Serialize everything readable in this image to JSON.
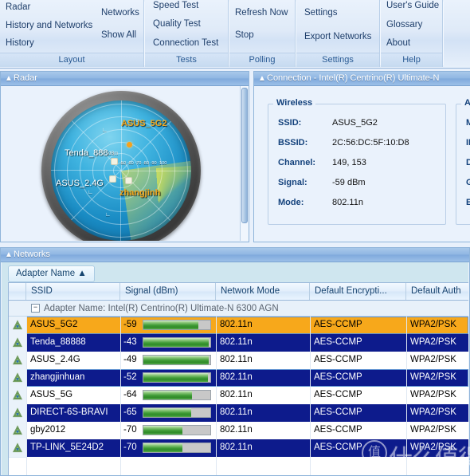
{
  "ribbon": {
    "groups": [
      {
        "label": "Layout",
        "items": [
          {
            "label": "Radar"
          },
          {
            "label": "History and Networks"
          },
          {
            "label": "History"
          },
          {
            "label": "Networks"
          },
          {
            "label": "Show All"
          }
        ]
      },
      {
        "label": "Tests",
        "items": [
          {
            "label": "Speed Test"
          },
          {
            "label": "Quality Test"
          },
          {
            "label": "Connection Test"
          }
        ]
      },
      {
        "label": "Polling",
        "items": [
          {
            "label": "Refresh Now"
          },
          {
            "label": "Stop"
          }
        ]
      },
      {
        "label": "Settings",
        "items": [
          {
            "label": "Settings"
          },
          {
            "label": "Export Networks"
          }
        ]
      },
      {
        "label": "Help",
        "items": [
          {
            "label": "User's Guide"
          },
          {
            "label": "Glossary"
          },
          {
            "label": "About"
          }
        ]
      }
    ]
  },
  "radar_panel": {
    "title": "Radar",
    "collapse_icon": "chevron-up-icon",
    "scale_unit": "dBm",
    "scale_ticks": "-50 -60 -70 -80 -90 -100",
    "access_points": [
      {
        "ssid": "ASUS_5G2",
        "highlight": true
      },
      {
        "ssid": "Tenda_888",
        "highlight": false
      },
      {
        "ssid": "ASUS_2.4G",
        "highlight": false
      },
      {
        "ssid": "zhangjinh",
        "highlight": true
      }
    ]
  },
  "connection_panel": {
    "title": "Connection - Intel(R) Centrino(R) Ultimate-N",
    "collapse_icon": "chevron-up-icon",
    "wireless": {
      "legend": "Wireless",
      "rows": [
        {
          "label": "SSID:",
          "value": "ASUS_5G2"
        },
        {
          "label": "BSSID:",
          "value": "2C:56:DC:5F:10:D8"
        },
        {
          "label": "Channel:",
          "value": "149, 153"
        },
        {
          "label": "Signal:",
          "value": "-59 dBm"
        },
        {
          "label": "Mode:",
          "value": "802.11n"
        }
      ]
    },
    "address": {
      "legend": "Addr",
      "rows": [
        {
          "label": "M"
        },
        {
          "label": "IP"
        },
        {
          "label": "D"
        },
        {
          "label": "G"
        },
        {
          "label": "Ex"
        }
      ]
    }
  },
  "networks_panel": {
    "title": "Networks",
    "collapse_icon": "chevron-up-icon",
    "group_button": "Adapter Name ▲",
    "group_row": "Adapter Name: Intel(R) Centrino(R) Ultimate-N 6300 AGN",
    "expander": "−",
    "columns": [
      {
        "label": "SSID"
      },
      {
        "label": "Signal (dBm)"
      },
      {
        "label": "Network Mode"
      },
      {
        "label": "Default Encrypti..."
      },
      {
        "label": "Default Auth"
      }
    ],
    "rows": [
      {
        "icon": "wireless-network-icon",
        "ssid": "ASUS_5G2",
        "signal": "-59",
        "bar_pct": 82,
        "mode": "802.11n",
        "encryption": "AES-CCMP",
        "auth": "WPA2/PSK",
        "style": "orange",
        "selected": true
      },
      {
        "icon": "wireless-network-icon",
        "ssid": "Tenda_88888",
        "signal": "-43",
        "bar_pct": 98,
        "mode": "802.11n",
        "encryption": "AES-CCMP",
        "auth": "WPA2/PSK",
        "style": "navy",
        "selected": false
      },
      {
        "icon": "wireless-network-icon",
        "ssid": "ASUS_2.4G",
        "signal": "-49",
        "bar_pct": 98,
        "mode": "802.11n",
        "encryption": "AES-CCMP",
        "auth": "WPA2/PSK",
        "style": "white",
        "selected": false
      },
      {
        "icon": "wireless-network-icon",
        "ssid": "zhangjinhuan",
        "signal": "-52",
        "bar_pct": 97,
        "mode": "802.11n",
        "encryption": "AES-CCMP",
        "auth": "WPA2/PSK",
        "style": "navy",
        "selected": true
      },
      {
        "icon": "wireless-network-icon",
        "ssid": "ASUS_5G",
        "signal": "-64",
        "bar_pct": 73,
        "mode": "802.11n",
        "encryption": "AES-CCMP",
        "auth": "WPA2/PSK",
        "style": "white",
        "selected": false
      },
      {
        "icon": "wireless-network-icon",
        "ssid": "DIRECT-6S-BRAVI",
        "signal": "-65",
        "bar_pct": 72,
        "mode": "802.11n",
        "encryption": "AES-CCMP",
        "auth": "WPA2/PSK",
        "style": "navy",
        "selected": false
      },
      {
        "icon": "wireless-network-icon",
        "ssid": "gby2012",
        "signal": "-70",
        "bar_pct": 58,
        "mode": "802.11n",
        "encryption": "AES-CCMP",
        "auth": "WPA2/PSK",
        "style": "white",
        "selected": false
      },
      {
        "icon": "wireless-network-icon",
        "ssid": "TP-LINK_5E24D2",
        "signal": "-70",
        "bar_pct": 58,
        "mode": "802.11n",
        "encryption": "AES-CCMP",
        "auth": "WPA2/PSK",
        "style": "navy",
        "selected": false
      }
    ]
  },
  "watermark": {
    "text": "什么值得买",
    "logo": "值"
  },
  "colors": {
    "selected_row": "#f7a81b",
    "alt_row": "#0d1b8c",
    "panel_header": "#8fb6e2",
    "signal_bar": "#3e9b35"
  }
}
